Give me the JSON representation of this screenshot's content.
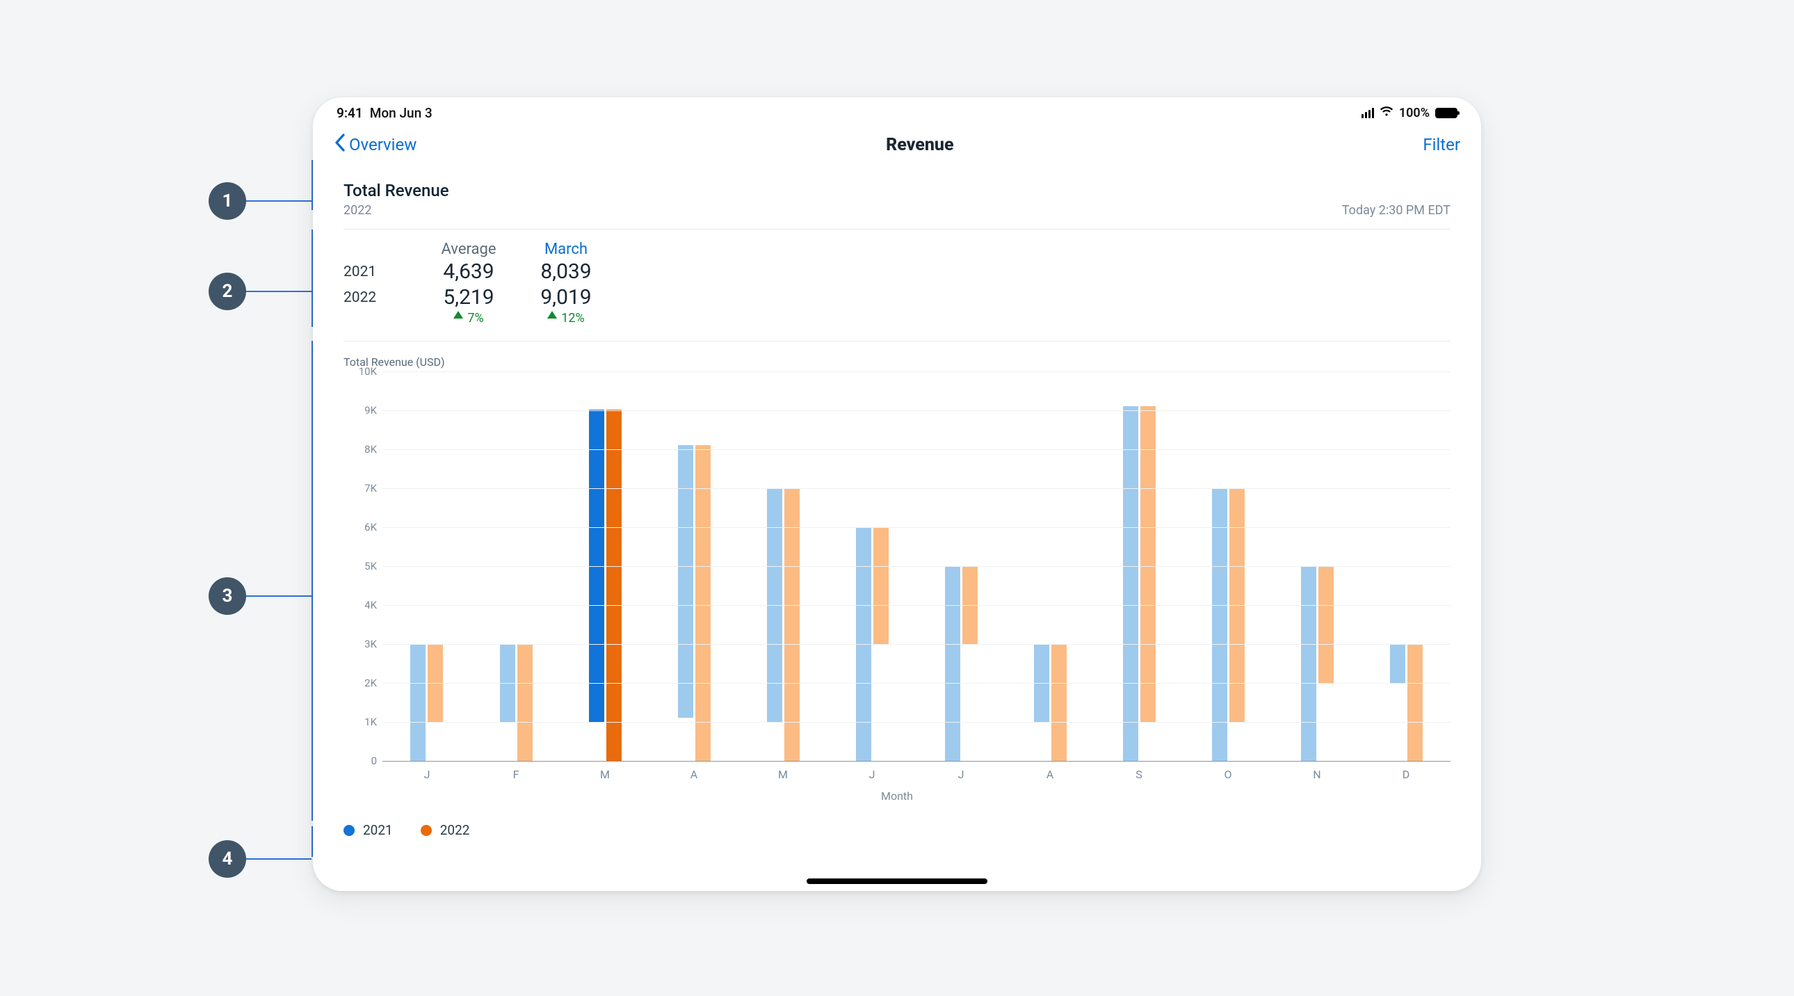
{
  "status": {
    "time": "9:41",
    "date": "Mon Jun 3",
    "battery_pct": "100%"
  },
  "nav": {
    "back_label": "Overview",
    "title": "Revenue",
    "filter_label": "Filter"
  },
  "header": {
    "title": "Total Revenue",
    "subtitle": "2022",
    "timestamp": "Today 2:30 PM EDT"
  },
  "metrics": {
    "col1_label": "Average",
    "col2_label": "March",
    "rows": [
      {
        "year": "2021",
        "avg": "4,639",
        "month": "8,039"
      },
      {
        "year": "2022",
        "avg": "5,219",
        "month": "9,019"
      }
    ],
    "change": {
      "avg": "7%",
      "month": "12%"
    }
  },
  "legend": {
    "s1": "2021",
    "s2": "2022"
  },
  "annotations": [
    "1",
    "2",
    "3",
    "4"
  ],
  "chart_data": {
    "type": "bar",
    "title": "Total Revenue (USD)",
    "xlabel": "Month",
    "ylabel": "",
    "ylim": [
      0,
      10000
    ],
    "y_ticks": [
      "0",
      "1K",
      "2K",
      "3K",
      "4K",
      "5K",
      "6K",
      "7K",
      "8K",
      "9K",
      "10K"
    ],
    "categories": [
      "J",
      "F",
      "M",
      "A",
      "M",
      "J",
      "J",
      "A",
      "S",
      "O",
      "N",
      "D"
    ],
    "selected_index": 2,
    "series": [
      {
        "name": "2021",
        "color": "#1273d8",
        "values": [
          3000,
          2000,
          8039,
          7000,
          6000,
          6000,
          5000,
          2000,
          9100,
          7000,
          5000,
          1000
        ]
      },
      {
        "name": "2022",
        "color": "#e96b0c",
        "values": [
          2000,
          3000,
          9019,
          8100,
          7000,
          3000,
          2000,
          3000,
          8100,
          6000,
          3000,
          3000
        ]
      }
    ],
    "legend_position": "bottom-left",
    "grid": true
  }
}
